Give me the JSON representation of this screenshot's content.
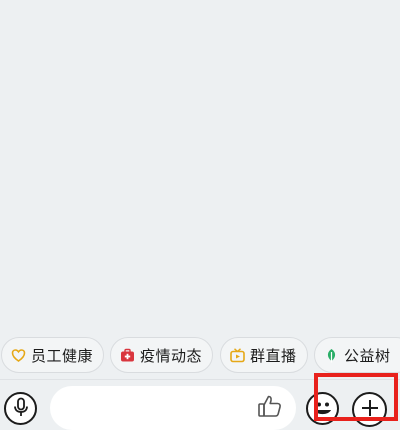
{
  "quick_actions": [
    {
      "label": "员工健康",
      "icon": "heart-shield-icon",
      "color": "#e6a817"
    },
    {
      "label": "疫情动态",
      "icon": "medical-kit-icon",
      "color": "#d9363e"
    },
    {
      "label": "群直播",
      "icon": "tv-icon",
      "color": "#e6a817"
    },
    {
      "label": "公益树",
      "icon": "leaf-icon",
      "color": "#2aae67"
    }
  ],
  "input_bar": {
    "placeholder": "",
    "voice_icon": "microphone-icon",
    "like_icon": "thumbs-up-icon",
    "emoji_icon": "emoji-icon",
    "more_icon": "plus-icon"
  },
  "highlight": {
    "color": "#e8211c",
    "target": "plus-button"
  }
}
